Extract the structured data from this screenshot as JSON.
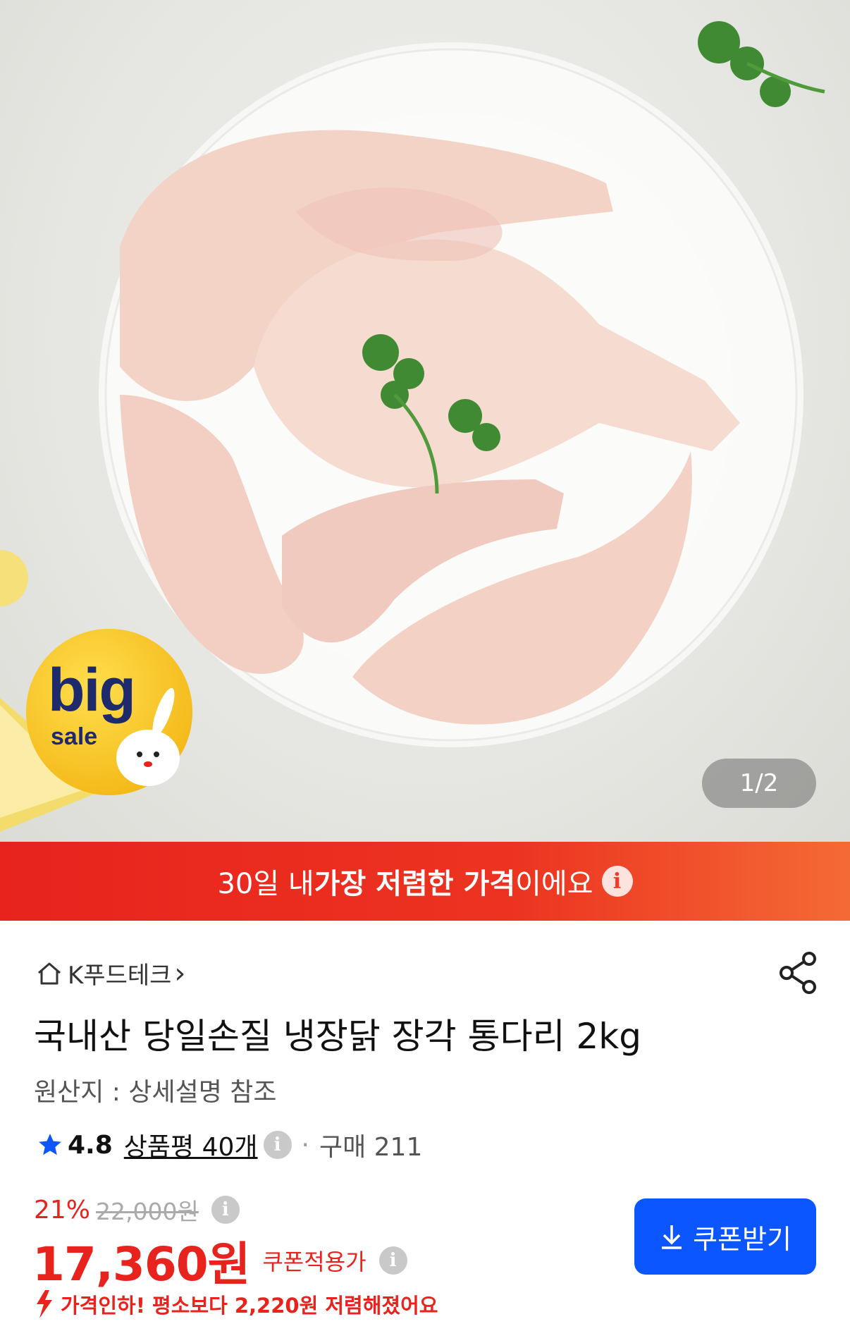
{
  "gallery": {
    "counter": "1/2",
    "badge_big": "big",
    "badge_sale": "sale"
  },
  "banner": {
    "prefix": "30일 내 ",
    "highlight": "가장 저렴한 가격",
    "suffix": "이에요",
    "info_icon": "i"
  },
  "product": {
    "store": "K푸드테크",
    "store_chevron": "›",
    "title": "국내산 당일손질 냉장닭 장각 통다리 2kg",
    "origin": "원산지 : 상세설명 참조",
    "rating": "4.8",
    "reviews": "상품평 40개",
    "info_icon": "i",
    "dot": "·",
    "purchases": "구매 211"
  },
  "pricing": {
    "discount": "21%",
    "original": "22,000원",
    "info_icon": "i",
    "price": "17,360원",
    "coupon_price_label": "쿠폰적용가",
    "coupon_button": "쿠폰받기",
    "price_drop": "가격인하! 평소보다 2,220원 저렴해졌어요"
  },
  "colors": {
    "accent_red": "#e8231e",
    "accent_blue": "#0b56ff",
    "banner_orange": "#f46a35"
  }
}
